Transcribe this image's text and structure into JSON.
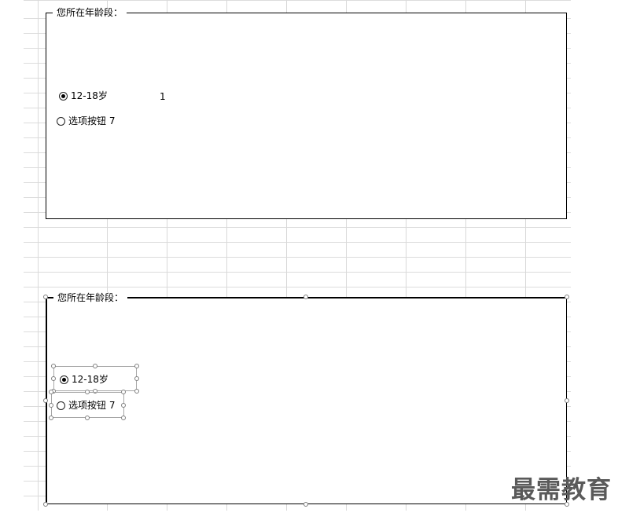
{
  "top_group": {
    "title": "您所在年龄段：",
    "options": [
      {
        "label": "12-18岁",
        "checked": true
      },
      {
        "label": "选项按钮 7",
        "checked": false
      }
    ],
    "linked_cell_value": "1"
  },
  "bottom_group": {
    "title": "您所在年龄段：",
    "options": [
      {
        "label": "12-18岁",
        "checked": true
      },
      {
        "label": "选项按钮 7",
        "checked": false
      }
    ]
  },
  "watermark": "最需教育"
}
